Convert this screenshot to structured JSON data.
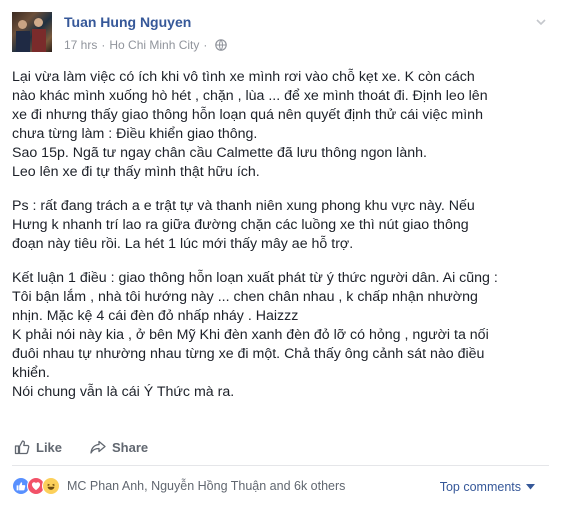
{
  "post": {
    "author": "Tuan Hung Nguyen",
    "time": "17 hrs",
    "location": "Ho Chi Minh City",
    "separator": "·",
    "privacy_icon": "globe-icon",
    "paragraphs": [
      [
        "Lại vừa làm việc có ích khi vô tình xe mình rơi vào chỗ kẹt xe. K còn cách",
        "nào khác mình xuống hò hét , chặn , lùa ... để xe mình thoát đi. Định leo lên",
        "xe đi nhưng thấy giao thông hỗn loạn quá nên quyết định thử cái việc mình",
        "chưa từng làm : Điều khiển giao thông.",
        "Sao 15p. Ngã tư ngay chân cầu Calmette đã lưu thông ngon lành.",
        "Leo lên xe đi tự thấy mình thật hữu ích."
      ],
      [
        "Ps : rất đang trách a e trật tự và thanh niên xung phong khu vực này. Nếu",
        "Hưng k nhanh trí lao ra giữa đường chặn các luồng xe thì nút giao thông",
        "đoạn này tiêu rồi. La hét 1 lúc mới thấy mây ae hỗ trợ."
      ],
      [
        "Kết luận 1 điều : giao thông hỗn loạn xuất phát từ ý thức người dân. Ai cũng :",
        "Tôi bận lắm , nhà tôi hướng này ... chen chân nhau , k chấp nhận nhường",
        "nhịn. Mặc kệ 4 cái đèn đỏ nhấp nháy . Haizzz",
        "K phải nói này kia , ở bên Mỹ Khi đèn xanh đèn đỏ lỡ có hỏng , người ta nối",
        "đuôi nhau tự nhường nhau từng xe đi một. Chả thấy ông cảnh sát nào điều",
        "khiển.",
        "Nói chung vẫn là cái Ý Thức mà ra."
      ]
    ]
  },
  "actions": {
    "like_label": "Like",
    "share_label": "Share"
  },
  "reactions": {
    "icons": [
      "like-reaction-icon",
      "love-reaction-icon",
      "haha-reaction-icon"
    ],
    "summary": "MC Phan Anh, Nguyễn Hồng Thuận and 6k others"
  },
  "comments": {
    "sort_label": "Top comments"
  },
  "colors": {
    "link": "#365899",
    "meta": "#90949c",
    "like_reaction": "#5890ff",
    "love_reaction": "#f25268",
    "haha_reaction": "#fcd05b"
  }
}
